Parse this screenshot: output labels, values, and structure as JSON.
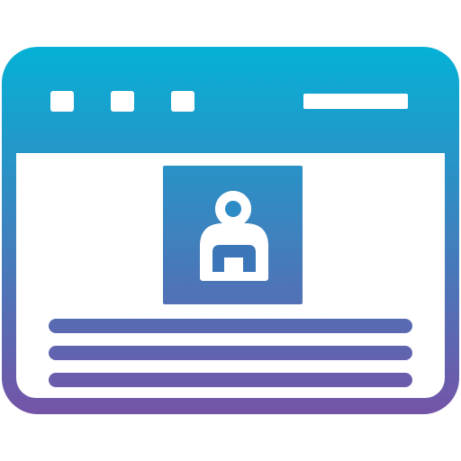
{
  "icon": {
    "name": "browser-window-profile-icon",
    "gradient": {
      "top": "#05b1d6",
      "bottom": "#7454a7"
    },
    "title_bar": {
      "buttons": [
        "window-button-1",
        "window-button-2",
        "window-button-3"
      ],
      "address_bar": "address-bar"
    },
    "content": {
      "avatar": "user-profile-icon",
      "text_lines": 3
    }
  }
}
